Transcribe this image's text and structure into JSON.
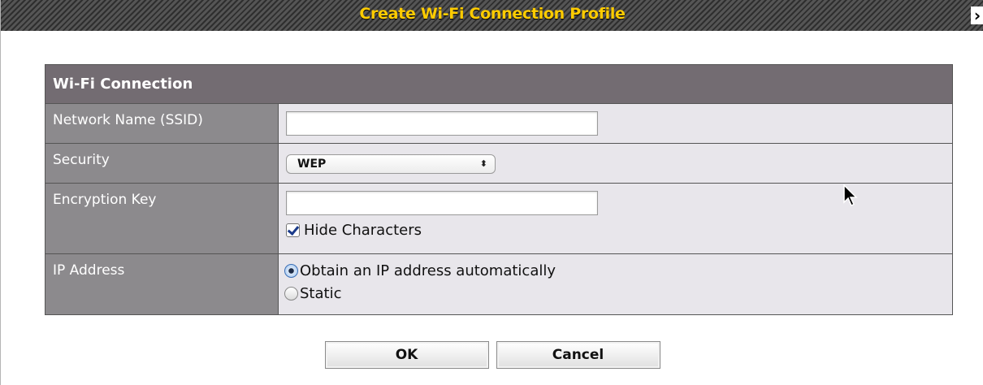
{
  "dialog": {
    "title": "Create Wi-Fi Connection Profile",
    "close_icon": "close-icon"
  },
  "panel": {
    "header": "Wi-Fi Connection",
    "rows": {
      "ssid": {
        "label": "Network Name (SSID)",
        "value": ""
      },
      "security": {
        "label": "Security",
        "selected": "WEP"
      },
      "key": {
        "label": "Encryption Key",
        "value": "",
        "hide_label": "Hide Characters",
        "hide_checked": true
      },
      "ip": {
        "label": "IP Address",
        "options": [
          "Obtain an IP address automatically",
          "Static"
        ],
        "selected_index": 0
      }
    }
  },
  "buttons": {
    "ok": "OK",
    "cancel": "Cancel"
  },
  "colors": {
    "title_text": "#ffcc00",
    "header_bg": "#736c72",
    "label_bg": "#8c8a8d",
    "value_bg": "#e8e6eb"
  }
}
